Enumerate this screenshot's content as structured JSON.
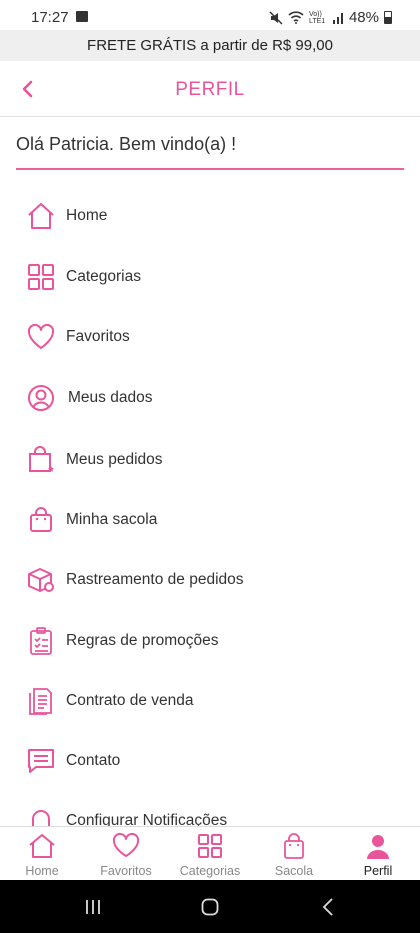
{
  "status_bar": {
    "time": "17:27",
    "network": "Vo)) LTE1",
    "battery": "48%"
  },
  "promo": {
    "text": "FRETE GRÁTIS  a partir de R$ 99,00"
  },
  "header": {
    "title": "PERFIL",
    "back_icon": "chevron-left-icon"
  },
  "greeting": "Olá Patricia. Bem vindo(a) !",
  "colors": {
    "accent": "#e9559b",
    "text": "#333333",
    "promo_bg": "#efefef"
  },
  "menu": [
    {
      "label": "Home",
      "icon": "home-icon"
    },
    {
      "label": "Categorias",
      "icon": "grid-icon"
    },
    {
      "label": "Favoritos",
      "icon": "heart-icon"
    },
    {
      "label": "Meus dados",
      "icon": "user-circle-icon"
    },
    {
      "label": "Meus pedidos",
      "icon": "shopping-bag-star-icon"
    },
    {
      "label": "Minha sacola",
      "icon": "bag-icon"
    },
    {
      "label": "Rastreamento de pedidos",
      "icon": "box-tracking-icon"
    },
    {
      "label": "Regras de promoções",
      "icon": "clipboard-list-icon"
    },
    {
      "label": "Contrato de venda",
      "icon": "document-icon"
    },
    {
      "label": "Contato",
      "icon": "chat-icon"
    },
    {
      "label": "Configurar Notificações",
      "icon": "bell-icon"
    }
  ],
  "tabs": [
    {
      "label": "Home",
      "icon": "home-icon",
      "active": false
    },
    {
      "label": "Favoritos",
      "icon": "heart-icon",
      "active": false
    },
    {
      "label": "Categorias",
      "icon": "grid-icon",
      "active": false
    },
    {
      "label": "Sacola",
      "icon": "bag-icon",
      "active": false
    },
    {
      "label": "Perfil",
      "icon": "person-icon",
      "active": true
    }
  ]
}
